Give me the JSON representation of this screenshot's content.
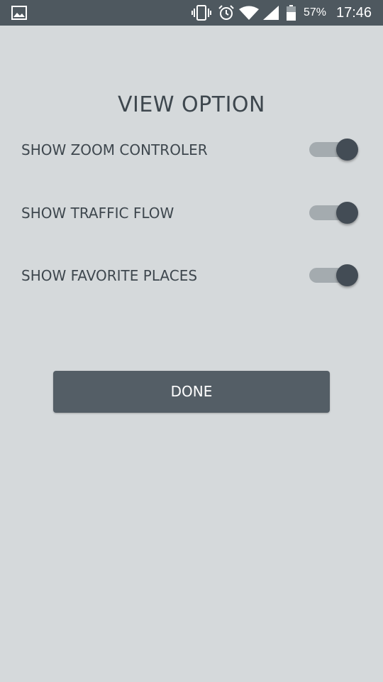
{
  "status_bar": {
    "battery_percent": "57%",
    "time": "17:46",
    "icons": [
      "gallery-icon",
      "vibrate-icon",
      "alarm-icon",
      "wifi-icon",
      "signal-icon",
      "battery-icon"
    ],
    "background_color": "#4e585f"
  },
  "dialog": {
    "title": "VIEW OPTION",
    "options": [
      {
        "label": "SHOW ZOOM CONTROLER",
        "enabled": true
      },
      {
        "label": "SHOW TRAFFIC FLOW",
        "enabled": true
      },
      {
        "label": "SHOW FAVORITE PLACES",
        "enabled": true
      }
    ],
    "done_label": "DONE"
  },
  "colors": {
    "background": "#d5d9db",
    "text": "#3e474e",
    "switch_track": "#a4abaf",
    "switch_thumb": "#434c55",
    "button": "#545e66"
  }
}
